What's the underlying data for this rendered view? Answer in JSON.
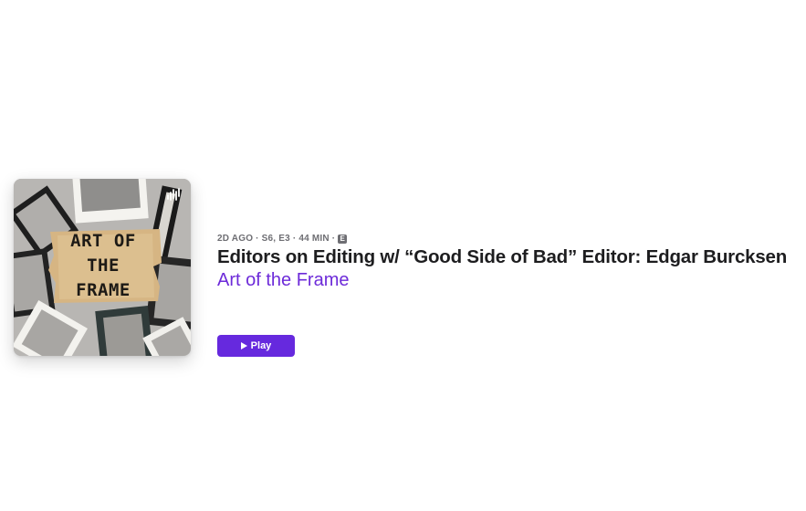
{
  "episode": {
    "meta": "2D AGO · S6, E3 · 44 MIN ·",
    "explicit_badge": "E",
    "title": "Editors on Editing w/ “Good Side of Bad” Editor: Edgar Burcksen",
    "show_name": "Art of the Frame",
    "play_label": "Play"
  },
  "artwork": {
    "title_lines": [
      "ART OF",
      "THE",
      "FRAME"
    ],
    "icon": "podcast-broadcast-icon"
  },
  "colors": {
    "accent": "#6629de",
    "show_link": "#6d2bd9",
    "meta_text": "#6e6e73",
    "title_text": "#1d1d1f"
  }
}
